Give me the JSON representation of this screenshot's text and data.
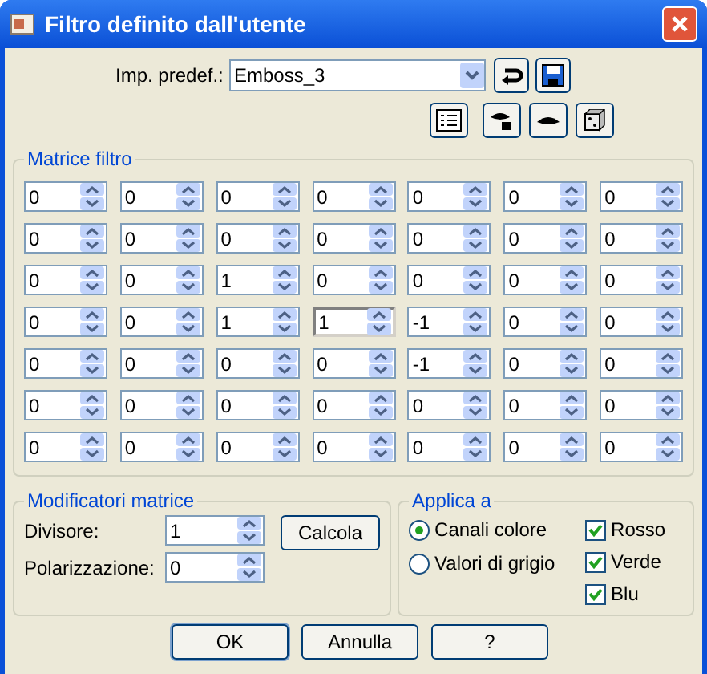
{
  "window": {
    "title": "Filtro definito dall'utente"
  },
  "preset": {
    "label": "Imp. predef.:",
    "value": "Emboss_3"
  },
  "filter_matrix": {
    "title": "Matrice filtro",
    "rows": [
      [
        {
          "value": "0",
          "focused": false
        },
        {
          "value": "0",
          "focused": false
        },
        {
          "value": "0",
          "focused": false
        },
        {
          "value": "0",
          "focused": false
        },
        {
          "value": "0",
          "focused": false
        },
        {
          "value": "0",
          "focused": false
        },
        {
          "value": "0",
          "focused": false
        }
      ],
      [
        {
          "value": "0",
          "focused": false
        },
        {
          "value": "0",
          "focused": false
        },
        {
          "value": "0",
          "focused": false
        },
        {
          "value": "0",
          "focused": false
        },
        {
          "value": "0",
          "focused": false
        },
        {
          "value": "0",
          "focused": false
        },
        {
          "value": "0",
          "focused": false
        }
      ],
      [
        {
          "value": "0",
          "focused": false
        },
        {
          "value": "0",
          "focused": false
        },
        {
          "value": "1",
          "focused": false
        },
        {
          "value": "0",
          "focused": false
        },
        {
          "value": "0",
          "focused": false
        },
        {
          "value": "0",
          "focused": false
        },
        {
          "value": "0",
          "focused": false
        }
      ],
      [
        {
          "value": "0",
          "focused": false
        },
        {
          "value": "0",
          "focused": false
        },
        {
          "value": "1",
          "focused": false
        },
        {
          "value": "1",
          "focused": true
        },
        {
          "value": "-1",
          "focused": false
        },
        {
          "value": "0",
          "focused": false
        },
        {
          "value": "0",
          "focused": false
        }
      ],
      [
        {
          "value": "0",
          "focused": false
        },
        {
          "value": "0",
          "focused": false
        },
        {
          "value": "0",
          "focused": false
        },
        {
          "value": "0",
          "focused": false
        },
        {
          "value": "-1",
          "focused": false
        },
        {
          "value": "0",
          "focused": false
        },
        {
          "value": "0",
          "focused": false
        }
      ],
      [
        {
          "value": "0",
          "focused": false
        },
        {
          "value": "0",
          "focused": false
        },
        {
          "value": "0",
          "focused": false
        },
        {
          "value": "0",
          "focused": false
        },
        {
          "value": "0",
          "focused": false
        },
        {
          "value": "0",
          "focused": false
        },
        {
          "value": "0",
          "focused": false
        }
      ],
      [
        {
          "value": "0",
          "focused": false
        },
        {
          "value": "0",
          "focused": false
        },
        {
          "value": "0",
          "focused": false
        },
        {
          "value": "0",
          "focused": false
        },
        {
          "value": "0",
          "focused": false
        },
        {
          "value": "0",
          "focused": false
        },
        {
          "value": "0",
          "focused": false
        }
      ]
    ]
  },
  "matrix_modifiers": {
    "title": "Modificatori matrice",
    "fields": [
      {
        "label": "Divisore:",
        "value": "1"
      },
      {
        "label": "Polarizzazione:",
        "value": "0"
      }
    ],
    "button": "Calcola"
  },
  "apply_to": {
    "title": "Applica a",
    "options": [
      {
        "label": "Canali colore",
        "selected": true
      },
      {
        "label": "Valori di grigio",
        "selected": false
      }
    ],
    "channels": [
      {
        "label": "Rosso",
        "checked": true
      },
      {
        "label": "Verde",
        "checked": true
      },
      {
        "label": "Blu",
        "checked": true
      }
    ]
  },
  "buttons": [
    "OK",
    "Annulla",
    "?"
  ]
}
